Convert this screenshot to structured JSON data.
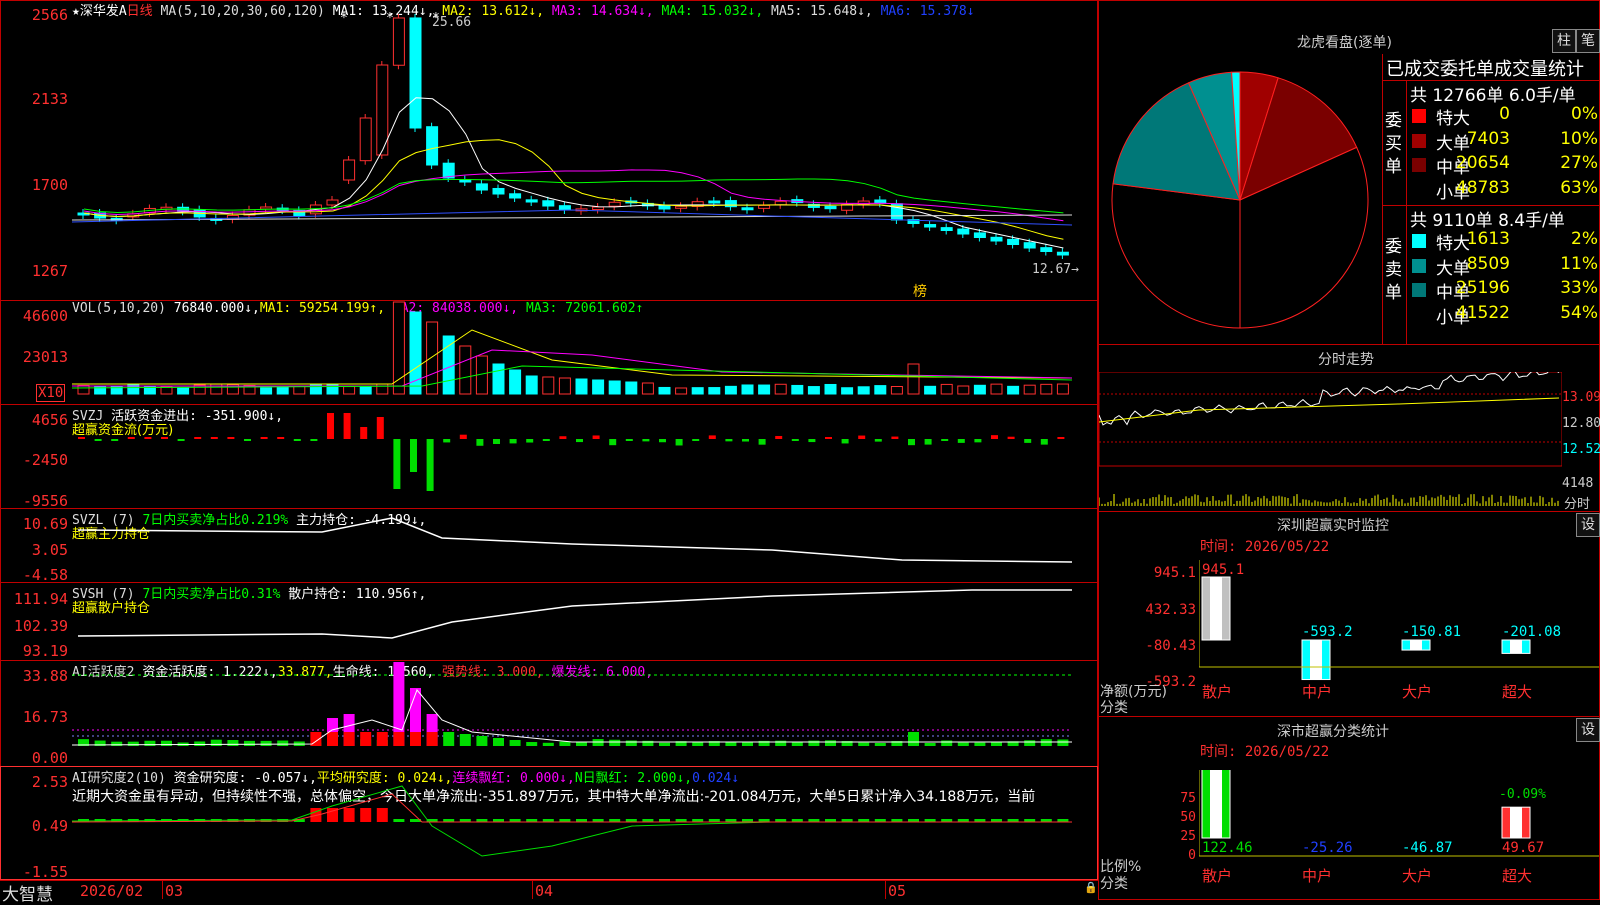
{
  "main": {
    "title_star": "★",
    "name": "深华发A",
    "period": "日线",
    "ma_label": "MA(5,10,20,30,60,120)",
    "ma1": "MA1: 13.244↓,",
    "ma2": "MA2: 13.612↓,",
    "ma3": "MA3: 14.634↓,",
    "ma4": "MA4: 15.032↓,",
    "ma5": "MA5: 15.648↓,",
    "ma6": "MA6: 15.378↓",
    "high_label": "25.66",
    "low_label": "12.67→",
    "bang": "榜",
    "yaxis": [
      "2566",
      "2133",
      "1700",
      "1267"
    ]
  },
  "vol": {
    "label": "VOL(5,10,20)",
    "value": "76840.000↓,",
    "ma1": "MA1: 59254.199↑,",
    "ma2": "MA2: 84038.000↓,",
    "ma3": "MA3: 72061.602↑",
    "yaxis": [
      "46600",
      "23013"
    ],
    "x10": "X10"
  },
  "svzj": {
    "label": "SVZJ",
    "text": "活跃资金进出: -351.900↓,",
    "sub": "超赢资金流(万元)",
    "yaxis": [
      "4656",
      "-2450",
      "-9556"
    ]
  },
  "svzl": {
    "label": "SVZL (7)",
    "text": "7日内买卖净占比0.219%",
    "text2": "主力持仓: -4.199↓,",
    "sub": "超赢主力持仓",
    "yaxis": [
      "10.69",
      "3.05",
      "-4.58"
    ]
  },
  "svsh": {
    "label": "SVSH (7)",
    "text": "7日内买卖净占比0.31%",
    "text2": "散户持仓: 110.956↑,",
    "sub": "超赢散户持仓",
    "yaxis": [
      "111.94",
      "102.39",
      "93.19"
    ]
  },
  "ai1": {
    "label": "AI活跃度2",
    "t1": "资金活跃度: 1.222↓,",
    "t2": "33.877,",
    "t3": "生命线: 1.560,",
    "t4": "强势线: 3.000,",
    "t5": "爆发线: 6.000,",
    "yaxis": [
      "33.88",
      "16.73",
      "0.00"
    ]
  },
  "ai2": {
    "label": "AI研究度2(10)",
    "t1": "资金研究度: -0.057↓,",
    "t2": "平均研究度: 0.024↓,",
    "t3": "连续飘红: 0.000↓,",
    "t4": "N日飘红: 2.000↓,",
    "t5": "0.024↓",
    "note": "近期大资金虽有异动，但持续性不强，总体偏空，今日大单净流出:-351.897万元，其中特大单净流出:-201.084万元，大单5日累计净入34.188万元，当前",
    "yaxis": [
      "2.53",
      "0.49",
      "-1.55"
    ]
  },
  "xaxis": {
    "brand": "大智慧",
    "labels": [
      "2026/02",
      "03",
      "04",
      "05"
    ]
  },
  "lhb": {
    "title": "龙虎看盘(逐单)",
    "btn1": "柱",
    "btn2": "笔",
    "header": "已成交委托单成交量统计",
    "buy_side": "委买单",
    "sell_side": "委卖单",
    "buy_total": "共 12766单 6.0手/单",
    "sell_total": "共 9110单 8.4手/单",
    "buy_rows": [
      {
        "name": "特大",
        "vol": "0",
        "pct": "0%",
        "color": "#ff0000"
      },
      {
        "name": "大单",
        "vol": "7403",
        "pct": "10%",
        "color": "#a00000"
      },
      {
        "name": "中单",
        "vol": "20654",
        "pct": "27%",
        "color": "#7a0000"
      },
      {
        "name": "小单",
        "vol": "48783",
        "pct": "63%",
        "color": "#000000"
      }
    ],
    "sell_rows": [
      {
        "name": "特大",
        "vol": "1613",
        "pct": "2%",
        "color": "#00ffff"
      },
      {
        "name": "大单",
        "vol": "8509",
        "pct": "11%",
        "color": "#009090"
      },
      {
        "name": "中单",
        "vol": "25196",
        "pct": "33%",
        "color": "#007878"
      },
      {
        "name": "小单",
        "vol": "41522",
        "pct": "54%",
        "color": "#000000"
      }
    ]
  },
  "fenshi": {
    "title": "分时走势",
    "y1": "13.09",
    "y2": "12.80",
    "y3": "12.52",
    "vol": "4148",
    "unit": "分时"
  },
  "szmon": {
    "title": "深圳超赢实时监控",
    "set": "设",
    "time": "时间: 2026/05/22",
    "yaxis": [
      "945.1",
      "432.33",
      "-80.43",
      "-593.2"
    ],
    "unit1": "净额(万元)",
    "unit2": "分类",
    "cats": [
      "散户",
      "中户",
      "大户",
      "超大"
    ],
    "values": [
      945.1,
      -593.2,
      -150.81,
      -201.08
    ],
    "labels": [
      "945.1",
      "-593.2",
      "-150.81",
      "-201.08"
    ]
  },
  "szcls": {
    "title": "深市超赢分类统计",
    "set": "设",
    "time": "时间: 2026/05/22",
    "yaxis": [
      "75",
      "50",
      "25",
      "0"
    ],
    "unit1": "比例%",
    "unit2": "分类",
    "cats": [
      "散户",
      "中户",
      "大户",
      "超大"
    ],
    "values": [
      122.46,
      -25.26,
      -46.87,
      49.67
    ],
    "labels": [
      "122.46",
      "-25.26",
      "-46.87",
      "49.67"
    ],
    "top_label": "-0.09%"
  },
  "colors": {
    "up": "#ff3030",
    "down": "#00ffff",
    "border": "#c00000",
    "green": "#00dd00",
    "magenta": "#ff00ff"
  }
}
